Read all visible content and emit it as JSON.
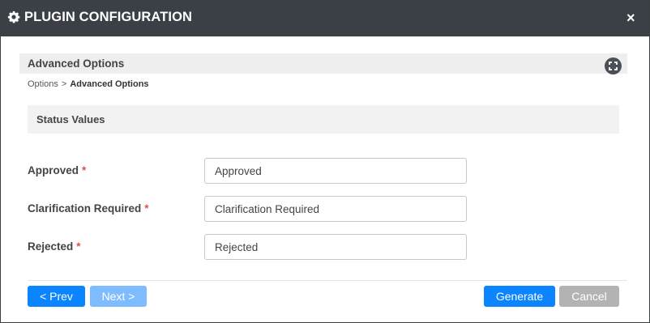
{
  "dialog": {
    "title": "PLUGIN CONFIGURATION",
    "close_symbol": "×"
  },
  "section": {
    "title": "Advanced Options",
    "expand_icon": "expand-icon"
  },
  "breadcrumb": {
    "parent": "Options",
    "separator": ">",
    "current": "Advanced Options"
  },
  "subsection": {
    "title": "Status Values"
  },
  "fields": [
    {
      "label": "Approved",
      "required_mark": "*",
      "value": "Approved"
    },
    {
      "label": "Clarification Required",
      "required_mark": "*",
      "value": "Clarification Required"
    },
    {
      "label": "Rejected",
      "required_mark": "*",
      "value": "Rejected"
    }
  ],
  "buttons": {
    "prev": "< Prev",
    "next": "Next >",
    "generate": "Generate",
    "cancel": "Cancel"
  },
  "colors": {
    "titlebar": "#3b4047",
    "primary": "#0a84ff",
    "primary_disabled": "#7fbcff",
    "cancel": "#b3b3b3",
    "required": "#d9534f"
  }
}
